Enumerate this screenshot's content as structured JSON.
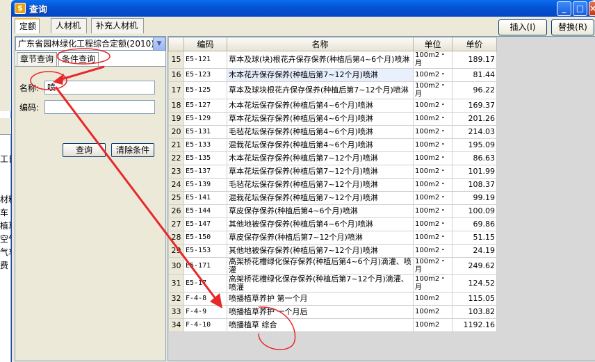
{
  "window": {
    "title": "查询",
    "app_icon": "app-icon",
    "buttons": [
      "_",
      "□",
      "×"
    ]
  },
  "tabs": [
    {
      "label": "定额",
      "active": true
    },
    {
      "label": "人材机"
    },
    {
      "label": "补充人材机"
    }
  ],
  "toolbar": {
    "insert_label": "插入(I)",
    "replace_label": "替换(R)"
  },
  "left_panel": {
    "quota_library": "广东省园林绿化工程综合定额(2010)",
    "subtabs": [
      {
        "label": "章节查询"
      },
      {
        "label": "条件查询",
        "active": true
      }
    ],
    "name_label": "名称:",
    "name_value": "喷",
    "code_label": "编码:",
    "code_value": "",
    "query_button": "查询",
    "clear_button": "清除条件"
  },
  "background_fragments": [
    "工日",
    "材料",
    "车",
    "植草",
    "空气",
    "气车",
    "费"
  ],
  "grid": {
    "columns": [
      "编码",
      "名称",
      "单位",
      "单价"
    ],
    "rows": [
      {
        "n": "15",
        "code": "E5-121",
        "name": "草本及球(块)根花卉保存保养(种植后第4~6个月)喷淋",
        "unit": "100m2・月",
        "price": "189.17"
      },
      {
        "n": "16",
        "code": "E5-123",
        "name": "木本花卉保存保养(种植后第7~12个月)喷淋",
        "unit": "100m2・",
        "price": "81.44"
      },
      {
        "n": "17",
        "code": "E5-125",
        "name": "草本及球块根花卉保存保养(种植后第7~12个月)喷淋",
        "unit": "100m2・月",
        "price": "96.22"
      },
      {
        "n": "18",
        "code": "E5-127",
        "name": "木本花坛保存保养(种植后第4~6个月)喷淋",
        "unit": "100m2・",
        "price": "169.37"
      },
      {
        "n": "19",
        "code": "E5-129",
        "name": "草本花坛保存保养(种植后第4~6个月)喷淋",
        "unit": "100m2・",
        "price": "201.26"
      },
      {
        "n": "20",
        "code": "E5-131",
        "name": "毛毡花坛保存保养(种植后第4~6个月)喷淋",
        "unit": "100m2・",
        "price": "214.03"
      },
      {
        "n": "21",
        "code": "E5-133",
        "name": "混栽花坛保存保养(种植后第4~6个月)喷淋",
        "unit": "100m2・",
        "price": "195.09"
      },
      {
        "n": "22",
        "code": "E5-135",
        "name": "木本花坛保存保养(种植后第7~12个月)喷淋",
        "unit": "100m2・",
        "price": "86.63"
      },
      {
        "n": "23",
        "code": "E5-137",
        "name": "草本花坛保存保养(种植后第7~12个月)喷淋",
        "unit": "100m2・",
        "price": "101.99"
      },
      {
        "n": "24",
        "code": "E5-139",
        "name": "毛毡花坛保存保养(种植后第7~12个月)喷淋",
        "unit": "100m2・",
        "price": "108.37"
      },
      {
        "n": "25",
        "code": "E5-141",
        "name": "混栽花坛保存保养(种植后第7~12个月)喷淋",
        "unit": "100m2・",
        "price": "99.19"
      },
      {
        "n": "26",
        "code": "E5-144",
        "name": "草皮保存保养(种植后第4~6个月)喷淋",
        "unit": "100m2・",
        "price": "100.09"
      },
      {
        "n": "27",
        "code": "E5-147",
        "name": "其他地被保存保养(种植后第4~6个月)喷淋",
        "unit": "100m2・",
        "price": "69.86"
      },
      {
        "n": "28",
        "code": "E5-150",
        "name": "草皮保存保养(种植后第7~12个月)喷淋",
        "unit": "100m2・",
        "price": "51.15"
      },
      {
        "n": "29",
        "code": "E5-153",
        "name": "其他地被保存保养(种植后第7~12个月)喷淋",
        "unit": "100m2・",
        "price": "24.19"
      },
      {
        "n": "30",
        "code": "E5-171",
        "name": "高架桥花槽绿化保存保养(种植后第4~6个月)滴灌、喷灌",
        "unit": "100m2・月",
        "price": "249.62"
      },
      {
        "n": "31",
        "code": "E5-17",
        "name": "高架桥花槽绿化保存保养(种植后第7~12个月)滴灌、喷灌",
        "unit": "100m2・月",
        "price": "124.52"
      },
      {
        "n": "32",
        "code": "F-4-8",
        "name": "喷播植草养护 第一个月",
        "unit": "100m2",
        "price": "115.05"
      },
      {
        "n": "33",
        "code": "F-4-9",
        "name": "喷播植草养护 一个月后",
        "unit": "100m2",
        "price": "103.82"
      },
      {
        "n": "34",
        "code": "F-4-10",
        "name": "喷播植草 综合",
        "unit": "100m2",
        "price": "1192.16"
      }
    ]
  },
  "colors": {
    "title_bar": "#0455d8",
    "annotation": "#e8272a"
  }
}
